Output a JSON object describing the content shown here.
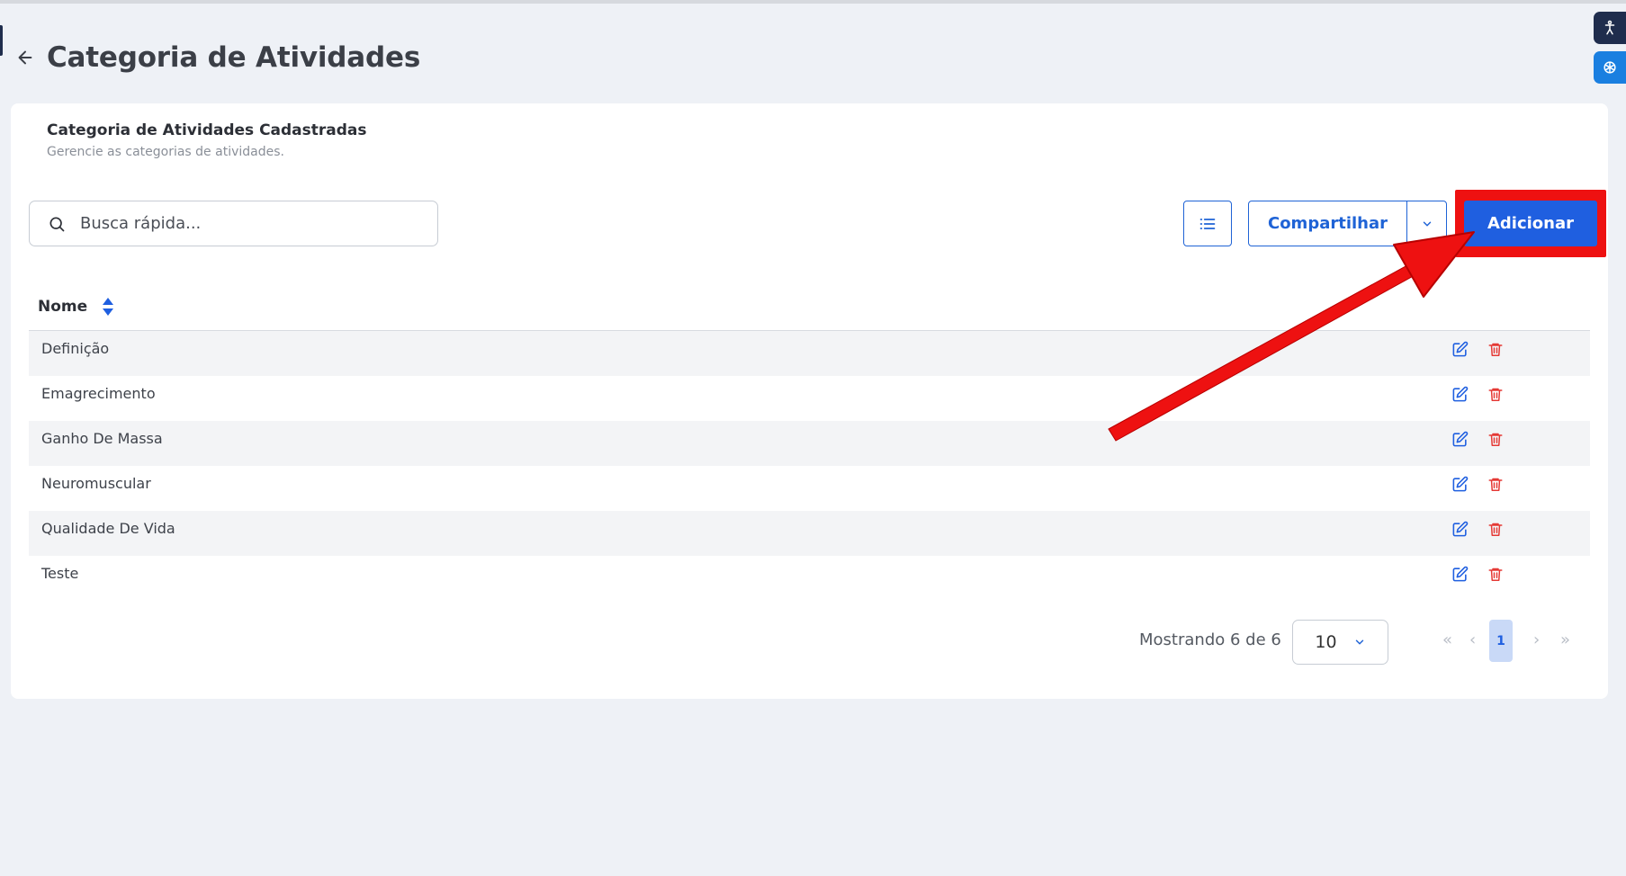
{
  "page": {
    "title": "Categoria de Atividades"
  },
  "card": {
    "title": "Categoria de Atividades Cadastradas",
    "subtitle": "Gerencie as categorias de atividades."
  },
  "search": {
    "placeholder": "Busca rápida..."
  },
  "toolbar": {
    "share_label": "Compartilhar",
    "add_label": "Adicionar"
  },
  "table": {
    "column": "Nome",
    "rows": [
      "Definição",
      "Emagrecimento",
      "Ganho De Massa",
      "Neuromuscular",
      "Qualidade De Vida",
      "Teste"
    ]
  },
  "pagination": {
    "info": "Mostrando 6 de 6",
    "per_page": "10",
    "current_page": "1",
    "first": "«",
    "prev": "‹",
    "next": "›",
    "last": "»"
  },
  "colors": {
    "primary": "#1f5fe0",
    "danger": "#e53935",
    "highlight": "#ee1111",
    "background": "#eef1f6"
  },
  "icons": [
    "back-arrow-icon",
    "accessibility-icon",
    "chatgpt-icon",
    "search-icon",
    "list-icon",
    "chevron-down-icon",
    "sort-icon",
    "edit-icon",
    "trash-icon"
  ]
}
